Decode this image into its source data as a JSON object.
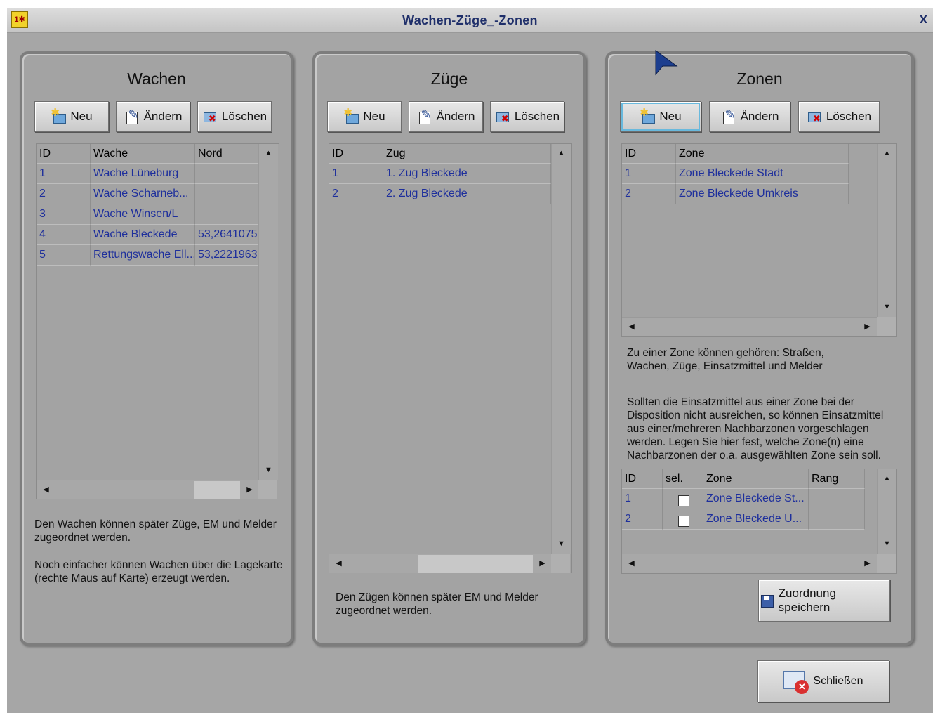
{
  "window": {
    "title": "Wachen-Züge_-Zonen",
    "close_glyph": "x"
  },
  "buttons": {
    "new": "Neu",
    "edit": "Ändern",
    "delete": "Löschen"
  },
  "wachen": {
    "title": "Wachen",
    "columns": [
      "ID",
      "Wache",
      "Nord"
    ],
    "rows": [
      [
        "1",
        "Wache Lüneburg",
        ""
      ],
      [
        "2",
        "Wache Scharneb...",
        ""
      ],
      [
        "3",
        "Wache Winsen/L",
        ""
      ],
      [
        "4",
        "Wache Bleckede",
        "53,2641075"
      ],
      [
        "5",
        "Rettungswache Ell...",
        "53,2221963"
      ]
    ],
    "note1": "Den Wachen können später Züge, EM und Melder zugeordnet werden.",
    "note2": "Noch einfacher können Wachen über die Lagekarte (rechte Maus auf Karte) erzeugt werden."
  },
  "zuege": {
    "title": "Züge",
    "columns": [
      "ID",
      "Zug"
    ],
    "rows": [
      [
        "1",
        "1. Zug Bleckede"
      ],
      [
        "2",
        "2. Zug Bleckede"
      ]
    ],
    "note": "Den Zügen können später EM und Melder zugeordnet werden."
  },
  "zonen": {
    "title": "Zonen",
    "columns": [
      "ID",
      "Zone"
    ],
    "rows": [
      [
        "1",
        "Zone Bleckede Stadt"
      ],
      [
        "2",
        "Zone Bleckede Umkreis"
      ]
    ],
    "note1": "Zu einer Zone können gehören: Straßen, Wachen, Züge, Einsatzmittel und Melder",
    "note2": "Sollten die Einsatzmittel aus einer Zone bei der Disposition nicht ausreichen, so können Einsatzmittel aus einer/mehreren Nachbarzonen vorgeschlagen werden. Legen Sie hier fest, welche Zone(n) eine Nachbarzonen der o.a. ausgewählten Zone sein soll.",
    "neighbor_columns": [
      "ID",
      "sel.",
      "Zone",
      "Rang"
    ],
    "neighbor_rows": [
      [
        "1",
        "",
        "Zone Bleckede St...",
        ""
      ],
      [
        "2",
        "",
        "Zone Bleckede U...",
        ""
      ]
    ],
    "save_label": "Zuordnung speichern"
  },
  "close_label": "Schließen",
  "icons": [
    "app-icon",
    "new-icon",
    "edit-icon",
    "delete-icon",
    "save-icon",
    "close-window-icon"
  ]
}
